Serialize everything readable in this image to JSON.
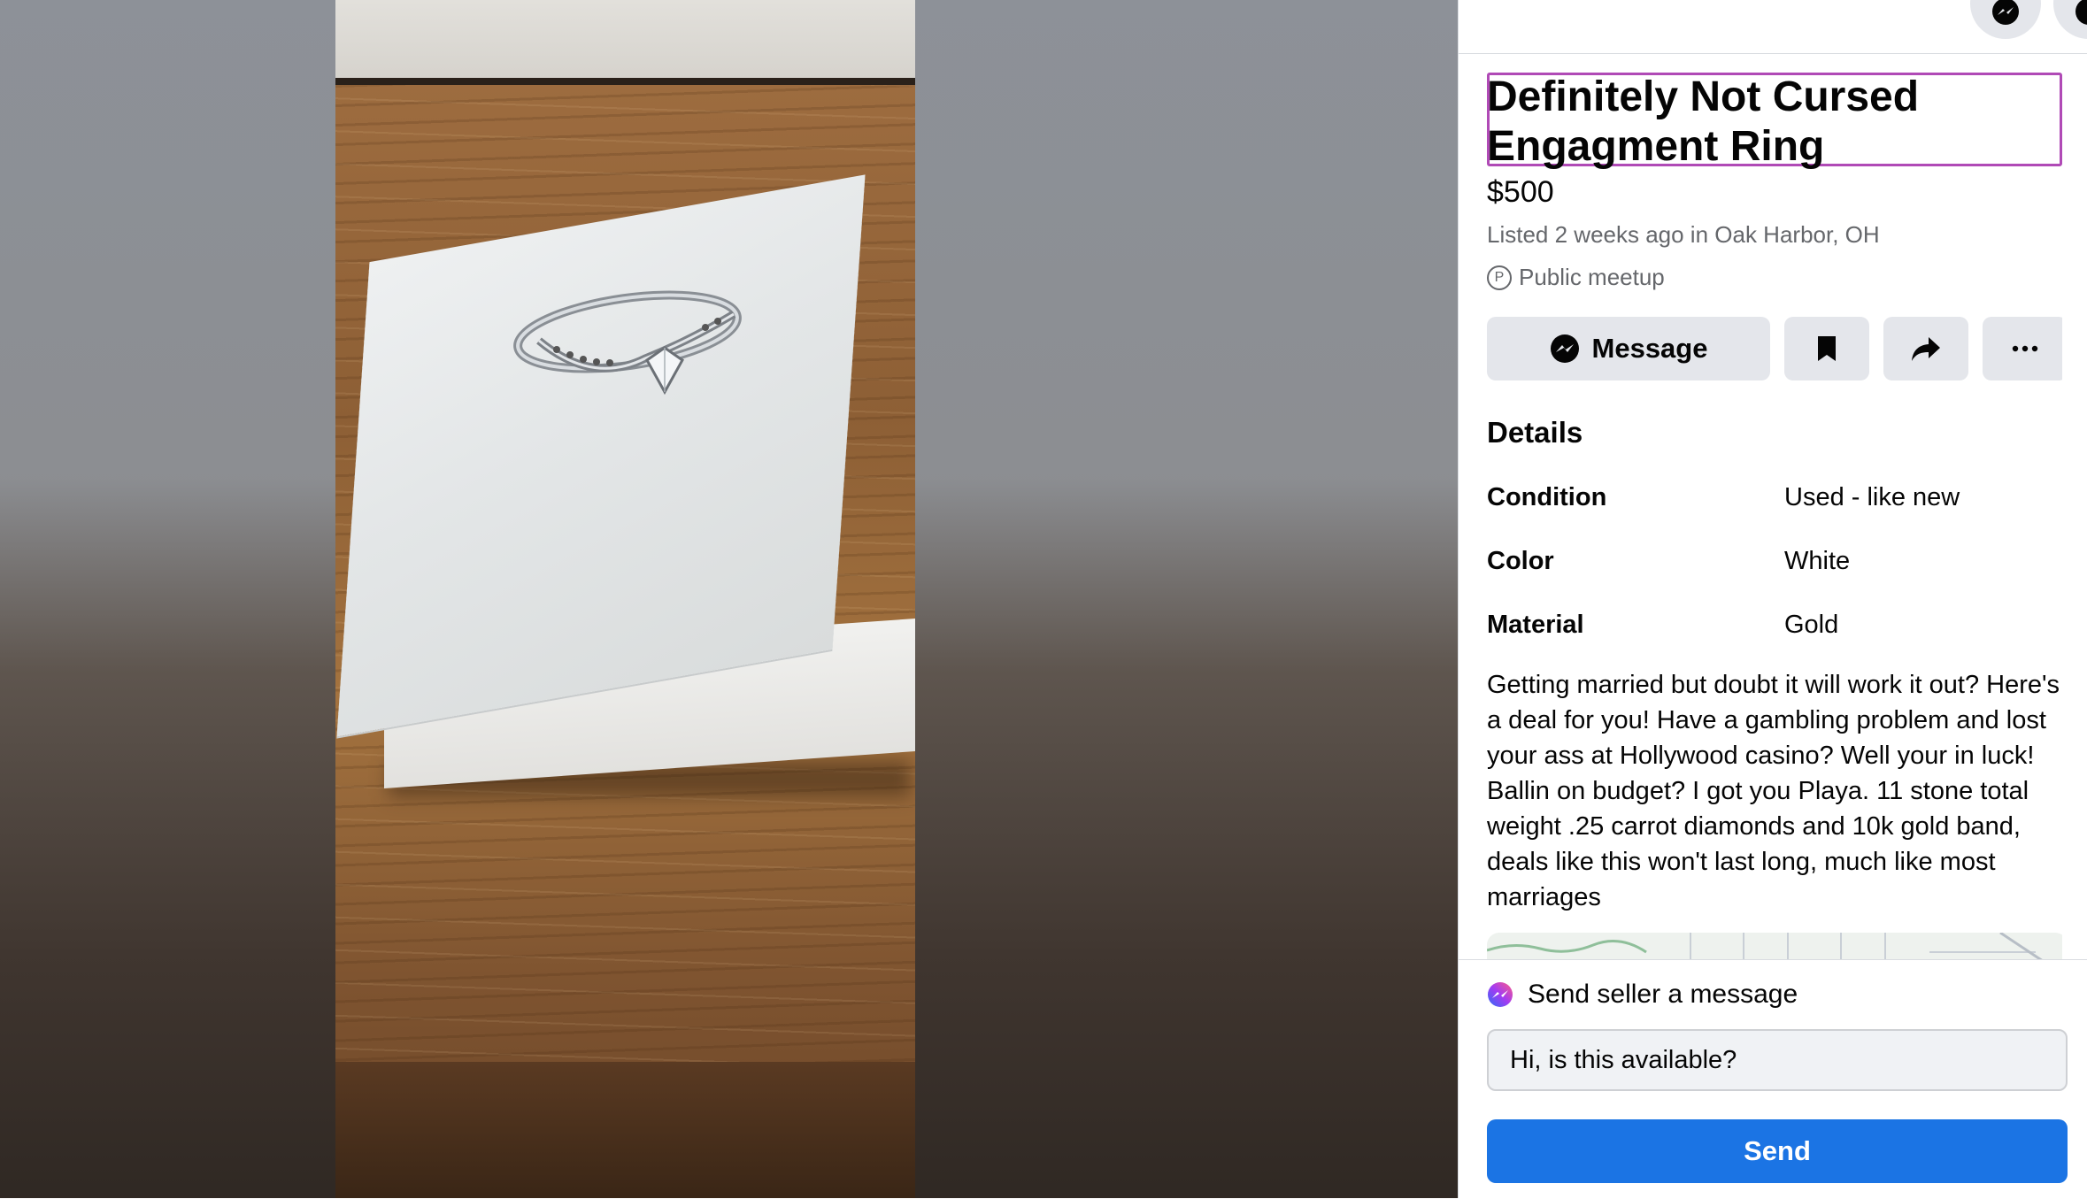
{
  "listing": {
    "title": "Definitely Not Cursed Engagment Ring",
    "price": "$500",
    "listed": "Listed 2 weeks ago in Oak Harbor, OH",
    "meetup": "Public meetup",
    "meetup_icon": "P"
  },
  "actions": {
    "message_label": "Message",
    "save_icon": "bookmark-icon",
    "share_icon": "share-icon",
    "more_icon": "more-icon"
  },
  "details": {
    "heading": "Details",
    "rows": [
      {
        "label": "Condition",
        "value": "Used - like new"
      },
      {
        "label": "Color",
        "value": "White"
      },
      {
        "label": "Material",
        "value": "Gold"
      }
    ],
    "description": "Getting married but doubt it will work it out? Here's a deal for you! Have a gambling problem and lost your ass at Hollywood casino? Well your in luck! Ballin on budget? I got you Playa. 11 stone total weight .25 carrot diamonds and 10k gold band, deals like this won't last long, much like most marriages"
  },
  "messaging": {
    "label": "Send seller a message",
    "input_value": "Hi, is this available?",
    "send_label": "Send"
  },
  "colors": {
    "accent": "#1b74e4",
    "highlight_border": "#b04ab6",
    "button_grey": "#e4e6eb",
    "secondary_text": "#65676b"
  }
}
